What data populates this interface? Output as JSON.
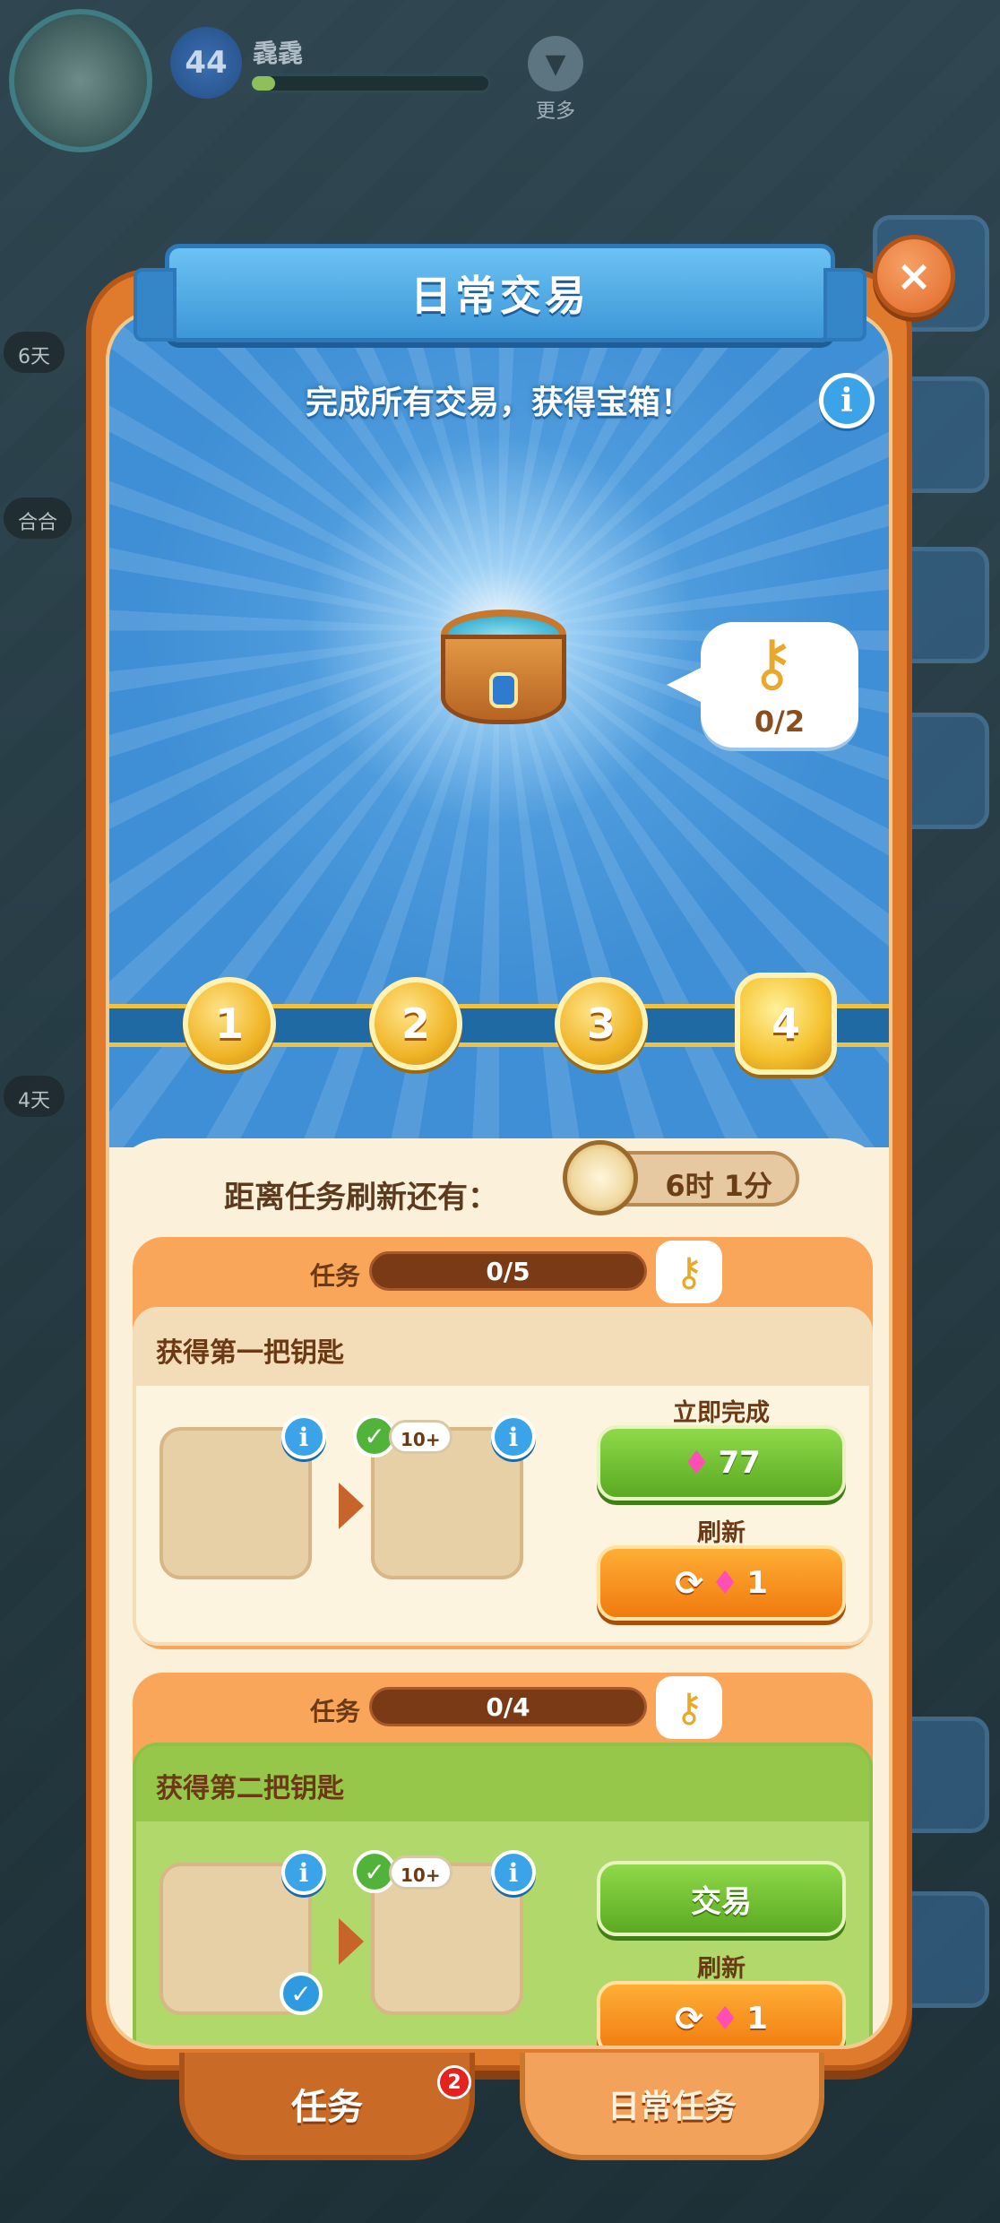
{
  "hud": {
    "level": "44",
    "player_name": "毳毳",
    "xp_fraction": 0.1,
    "more_label": "更多"
  },
  "background_timers": [
    "6天",
    "合合",
    "4天"
  ],
  "modal": {
    "title": "日常交易",
    "close_glyph": "×",
    "subtitle": "完成所有交易，获得宝箱！",
    "info_glyph": "i",
    "chest_key_count": "0/2",
    "steps": [
      "1",
      "2",
      "3",
      "4"
    ],
    "timer_label": "距离任务刷新还有：",
    "timer_value": "6时 1分",
    "tasks": [
      {
        "head_label": "任务",
        "progress": "0/5",
        "title": "获得第一把钥匙",
        "badge_count": "10+",
        "action_label": "立即完成",
        "action_button": "77",
        "refresh_label": "刷新",
        "refresh_cost": "1"
      },
      {
        "head_label": "任务",
        "progress": "0/4",
        "title": "获得第二把钥匙",
        "badge_count": "10+",
        "action_button": "交易",
        "refresh_label": "刷新",
        "refresh_cost": "1"
      }
    ]
  },
  "tabs": {
    "active": "任务",
    "active_badge": "2",
    "inactive": "日常任务"
  },
  "colors": {
    "frame_orange": "#e07a2c",
    "hero_blue": "#3f8fd6",
    "green_button": "#5aaa22",
    "orange_button": "#f07a0e",
    "gem_pink": "#ff4fb4"
  }
}
